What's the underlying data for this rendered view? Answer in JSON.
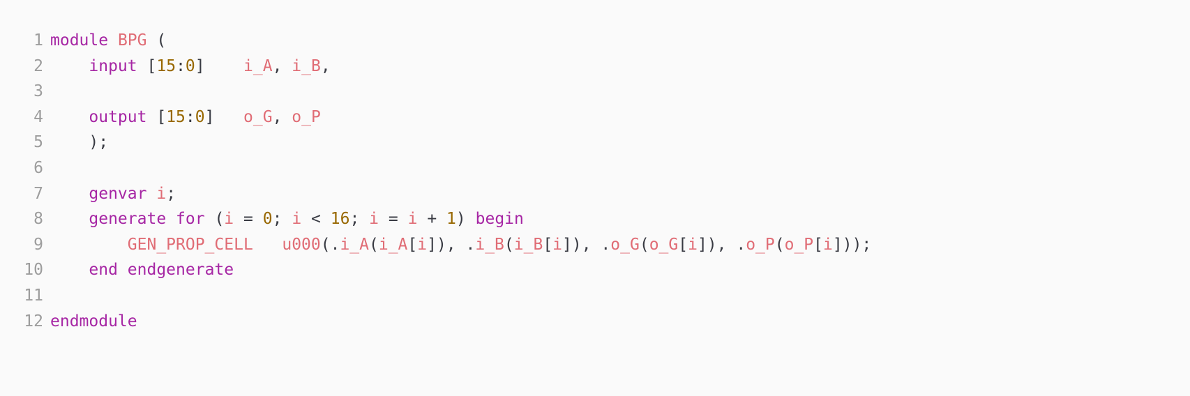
{
  "editor": {
    "language": "verilog",
    "background_color": "#fafafa",
    "line_number_color": "#9d9d9d",
    "colors": {
      "keyword": "#a626a4",
      "identifier": "#e06c75",
      "number": "#986801",
      "punctuation": "#383a42"
    },
    "lines": [
      {
        "number": "1",
        "text": "module BPG (",
        "tokens": [
          {
            "t": "module",
            "c": "keyword"
          },
          {
            "t": " ",
            "c": "plain"
          },
          {
            "t": "BPG",
            "c": "ident"
          },
          {
            "t": " ",
            "c": "plain"
          },
          {
            "t": "(",
            "c": "punct"
          }
        ]
      },
      {
        "number": "2",
        "text": "    input [15:0]    i_A, i_B,",
        "tokens": [
          {
            "t": "    ",
            "c": "plain"
          },
          {
            "t": "input",
            "c": "keyword"
          },
          {
            "t": " ",
            "c": "plain"
          },
          {
            "t": "[",
            "c": "punct"
          },
          {
            "t": "15",
            "c": "number"
          },
          {
            "t": ":",
            "c": "punct"
          },
          {
            "t": "0",
            "c": "number"
          },
          {
            "t": "]",
            "c": "punct"
          },
          {
            "t": "    ",
            "c": "plain"
          },
          {
            "t": "i_A",
            "c": "ident"
          },
          {
            "t": ",",
            "c": "punct"
          },
          {
            "t": " ",
            "c": "plain"
          },
          {
            "t": "i_B",
            "c": "ident"
          },
          {
            "t": ",",
            "c": "punct"
          }
        ]
      },
      {
        "number": "3",
        "text": "",
        "tokens": []
      },
      {
        "number": "4",
        "text": "    output [15:0]   o_G, o_P",
        "tokens": [
          {
            "t": "    ",
            "c": "plain"
          },
          {
            "t": "output",
            "c": "keyword"
          },
          {
            "t": " ",
            "c": "plain"
          },
          {
            "t": "[",
            "c": "punct"
          },
          {
            "t": "15",
            "c": "number"
          },
          {
            "t": ":",
            "c": "punct"
          },
          {
            "t": "0",
            "c": "number"
          },
          {
            "t": "]",
            "c": "punct"
          },
          {
            "t": "   ",
            "c": "plain"
          },
          {
            "t": "o_G",
            "c": "ident"
          },
          {
            "t": ",",
            "c": "punct"
          },
          {
            "t": " ",
            "c": "plain"
          },
          {
            "t": "o_P",
            "c": "ident"
          }
        ]
      },
      {
        "number": "5",
        "text": "    );",
        "tokens": [
          {
            "t": "    ",
            "c": "plain"
          },
          {
            "t": ");",
            "c": "punct"
          }
        ]
      },
      {
        "number": "6",
        "text": "",
        "tokens": []
      },
      {
        "number": "7",
        "text": "    genvar i;",
        "tokens": [
          {
            "t": "    ",
            "c": "plain"
          },
          {
            "t": "genvar",
            "c": "keyword"
          },
          {
            "t": " ",
            "c": "plain"
          },
          {
            "t": "i",
            "c": "ident"
          },
          {
            "t": ";",
            "c": "punct"
          }
        ]
      },
      {
        "number": "8",
        "text": "    generate for (i = 0; i < 16; i = i + 1) begin",
        "tokens": [
          {
            "t": "    ",
            "c": "plain"
          },
          {
            "t": "generate",
            "c": "keyword"
          },
          {
            "t": " ",
            "c": "plain"
          },
          {
            "t": "for",
            "c": "keyword"
          },
          {
            "t": " ",
            "c": "plain"
          },
          {
            "t": "(",
            "c": "punct"
          },
          {
            "t": "i",
            "c": "ident"
          },
          {
            "t": " ",
            "c": "plain"
          },
          {
            "t": "=",
            "c": "punct"
          },
          {
            "t": " ",
            "c": "plain"
          },
          {
            "t": "0",
            "c": "number"
          },
          {
            "t": ";",
            "c": "punct"
          },
          {
            "t": " ",
            "c": "plain"
          },
          {
            "t": "i",
            "c": "ident"
          },
          {
            "t": " ",
            "c": "plain"
          },
          {
            "t": "<",
            "c": "punct"
          },
          {
            "t": " ",
            "c": "plain"
          },
          {
            "t": "16",
            "c": "number"
          },
          {
            "t": ";",
            "c": "punct"
          },
          {
            "t": " ",
            "c": "plain"
          },
          {
            "t": "i",
            "c": "ident"
          },
          {
            "t": " ",
            "c": "plain"
          },
          {
            "t": "=",
            "c": "punct"
          },
          {
            "t": " ",
            "c": "plain"
          },
          {
            "t": "i",
            "c": "ident"
          },
          {
            "t": " ",
            "c": "plain"
          },
          {
            "t": "+",
            "c": "punct"
          },
          {
            "t": " ",
            "c": "plain"
          },
          {
            "t": "1",
            "c": "number"
          },
          {
            "t": ")",
            "c": "punct"
          },
          {
            "t": " ",
            "c": "plain"
          },
          {
            "t": "begin",
            "c": "keyword"
          }
        ]
      },
      {
        "number": "9",
        "text": "        GEN_PROP_CELL   u000(.i_A(i_A[i]), .i_B(i_B[i]), .o_G(o_G[i]), .o_P(o_P[i]));",
        "tokens": [
          {
            "t": "        ",
            "c": "plain"
          },
          {
            "t": "GEN_PROP_CELL",
            "c": "ident"
          },
          {
            "t": "   ",
            "c": "plain"
          },
          {
            "t": "u000",
            "c": "ident"
          },
          {
            "t": "(.",
            "c": "punct"
          },
          {
            "t": "i_A",
            "c": "ident"
          },
          {
            "t": "(",
            "c": "punct"
          },
          {
            "t": "i_A",
            "c": "ident"
          },
          {
            "t": "[",
            "c": "punct"
          },
          {
            "t": "i",
            "c": "ident"
          },
          {
            "t": "]), .",
            "c": "punct"
          },
          {
            "t": "i_B",
            "c": "ident"
          },
          {
            "t": "(",
            "c": "punct"
          },
          {
            "t": "i_B",
            "c": "ident"
          },
          {
            "t": "[",
            "c": "punct"
          },
          {
            "t": "i",
            "c": "ident"
          },
          {
            "t": "]), .",
            "c": "punct"
          },
          {
            "t": "o_G",
            "c": "ident"
          },
          {
            "t": "(",
            "c": "punct"
          },
          {
            "t": "o_G",
            "c": "ident"
          },
          {
            "t": "[",
            "c": "punct"
          },
          {
            "t": "i",
            "c": "ident"
          },
          {
            "t": "]), .",
            "c": "punct"
          },
          {
            "t": "o_P",
            "c": "ident"
          },
          {
            "t": "(",
            "c": "punct"
          },
          {
            "t": "o_P",
            "c": "ident"
          },
          {
            "t": "[",
            "c": "punct"
          },
          {
            "t": "i",
            "c": "ident"
          },
          {
            "t": "]));",
            "c": "punct"
          }
        ]
      },
      {
        "number": "10",
        "text": "    end endgenerate",
        "tokens": [
          {
            "t": "    ",
            "c": "plain"
          },
          {
            "t": "end",
            "c": "keyword"
          },
          {
            "t": " ",
            "c": "plain"
          },
          {
            "t": "endgenerate",
            "c": "keyword"
          }
        ]
      },
      {
        "number": "11",
        "text": "",
        "tokens": []
      },
      {
        "number": "12",
        "text": "endmodule",
        "tokens": [
          {
            "t": "endmodule",
            "c": "keyword"
          }
        ]
      }
    ]
  }
}
